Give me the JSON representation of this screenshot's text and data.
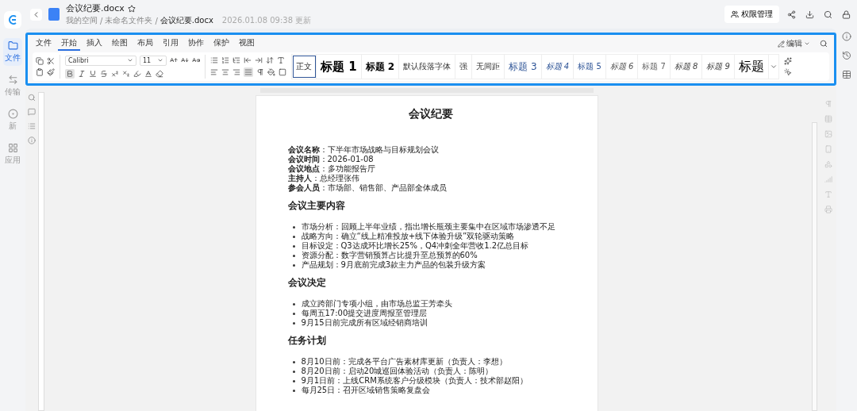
{
  "nav": {
    "items": [
      {
        "kind": "files",
        "label": "文件",
        "selected": true
      },
      {
        "kind": "transfer",
        "label": "传输",
        "selected": false
      },
      {
        "kind": "new",
        "label": "新",
        "selected": false
      },
      {
        "kind": "apps",
        "label": "应用",
        "selected": false
      }
    ]
  },
  "header": {
    "file_name": "会议纪要.docx",
    "breadcrumb": [
      "我的空间",
      "未命名文件夹",
      "会议纪要.docx"
    ],
    "separator": "/",
    "updated": "2026.01.08 09:38 更新",
    "permission_button": "权限管理"
  },
  "ribbon": {
    "tabs": [
      {
        "label": "文件",
        "selected": false
      },
      {
        "label": "开始",
        "selected": true
      },
      {
        "label": "插入",
        "selected": false
      },
      {
        "label": "绘图",
        "selected": false
      },
      {
        "label": "布局",
        "selected": false
      },
      {
        "label": "引用",
        "selected": false
      },
      {
        "label": "协作",
        "selected": false
      },
      {
        "label": "保护",
        "selected": false
      },
      {
        "label": "视图",
        "selected": false
      }
    ],
    "mode": "编辑",
    "font": "Calibri",
    "font_size": "11",
    "format_state": {
      "bold": true,
      "align_justify": true
    },
    "styles": [
      {
        "kind": "body",
        "label": "正文",
        "selected": true
      },
      {
        "kind": "h1",
        "label": "标题 1",
        "selected": false
      },
      {
        "kind": "h2",
        "label": "标题 2",
        "selected": false
      },
      {
        "kind": "small",
        "label": "默认段落字体",
        "selected": false
      },
      {
        "kind": "small",
        "label": "强",
        "selected": false
      },
      {
        "kind": "small",
        "label": "无间距",
        "selected": false
      },
      {
        "kind": "h3",
        "label": "标题 3",
        "selected": false
      },
      {
        "kind": "h4",
        "label": "标题 4",
        "selected": false
      },
      {
        "kind": "h5",
        "label": "标题 5",
        "selected": false
      },
      {
        "kind": "h6",
        "label": "标题 6",
        "selected": false
      },
      {
        "kind": "h7",
        "label": "标题 7",
        "selected": false
      },
      {
        "kind": "h8",
        "label": "标题 8",
        "selected": false
      },
      {
        "kind": "h9",
        "label": "标题 9",
        "selected": false
      },
      {
        "kind": "title",
        "label": "标题",
        "selected": false
      }
    ]
  },
  "document": {
    "title": "会议纪要",
    "fields": [
      {
        "label": "会议名称",
        "value": "：下半年市场战略与目标规划会议"
      },
      {
        "label": "会议时间",
        "value": "：2026-01-08"
      },
      {
        "label": "会议地点",
        "value": "：多功能报告厅"
      },
      {
        "label": "主持人",
        "value": "：总经理张伟"
      },
      {
        "label": "参会人员",
        "value": "：市场部、销售部、产品部全体成员"
      }
    ],
    "sections": [
      {
        "heading": "会议主要内容",
        "items": [
          "市场分析：回顾上半年业绩，指出增长瓶颈主要集中在区域市场渗透不足",
          "战略方向：确立“线上精准投放+线下体验升级”双轮驱动策略",
          "目标设定：Q3达成环比增长25%，Q4冲刺全年营收1.2亿总目标",
          "资源分配：数字营销预算占比提升至总预算的60%",
          "产品规划：9月底前完成3款主力产品的包装升级方案"
        ]
      },
      {
        "heading": "会议决定",
        "items": [
          "成立跨部门专项小组，由市场总监王芳牵头",
          "每周五17:00提交进度周报至管理层",
          "9月15日前完成所有区域经销商培训"
        ]
      },
      {
        "heading": "任务计划",
        "items": [
          "8月10日前：完成各平台广告素材库更新（负责人：李想）",
          "8月20日前：启动20城巡回体验活动（负责人：陈明）",
          "9月1日前：上线CRM系统客户分级模块（负责人：技术部赵阳）",
          "每月25日：召开区域销售策略复盘会"
        ]
      }
    ]
  }
}
